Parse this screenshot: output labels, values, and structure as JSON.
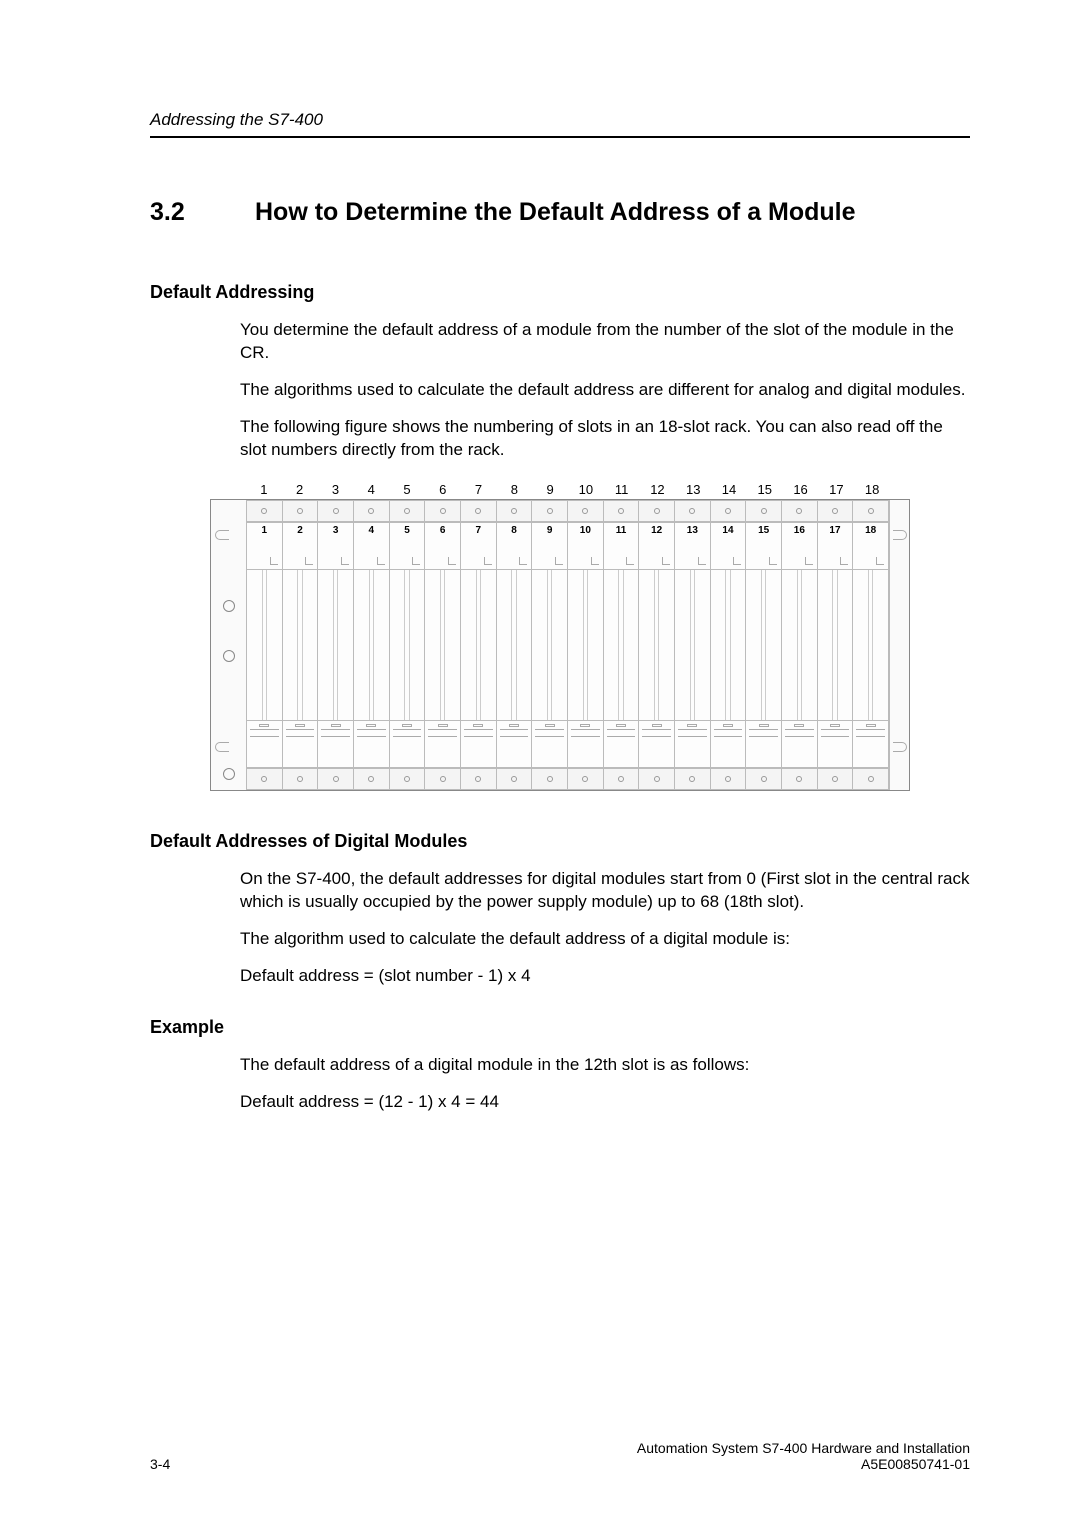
{
  "running_head": "Addressing the S7-400",
  "section": {
    "number": "3.2",
    "title": "How to Determine the Default Address of a Module"
  },
  "h_default_addressing": "Default Addressing",
  "p1": "You determine the default address of a module from the number of the slot of the module in the CR.",
  "p2": "The algorithms used to calculate the default address are different for analog and digital modules.",
  "p3": "The following figure shows the numbering of slots in an 18-slot rack. You can also read off the slot numbers directly from the rack.",
  "slots": [
    "1",
    "2",
    "3",
    "4",
    "5",
    "6",
    "7",
    "8",
    "9",
    "10",
    "11",
    "12",
    "13",
    "14",
    "15",
    "16",
    "17",
    "18"
  ],
  "h_digital": "Default Addresses of Digital Modules",
  "p4": "On the S7-400, the default addresses for digital modules start from 0 (First slot in the central rack which is usually occupied by the power supply module) up to 68 (18th slot).",
  "p5": "The algorithm used to calculate the default address of a digital module is:",
  "formula1": "Default address  =  (slot number - 1)  x 4",
  "h_example": "Example",
  "p6": "The default address of a digital module in the 12th slot is as follows:",
  "formula2": "Default address  =   (12 - 1)  x 4   =  44",
  "footer": {
    "page": "3-4",
    "doc_title": "Automation System S7-400  Hardware and Installation",
    "doc_id": "A5E00850741-01"
  }
}
